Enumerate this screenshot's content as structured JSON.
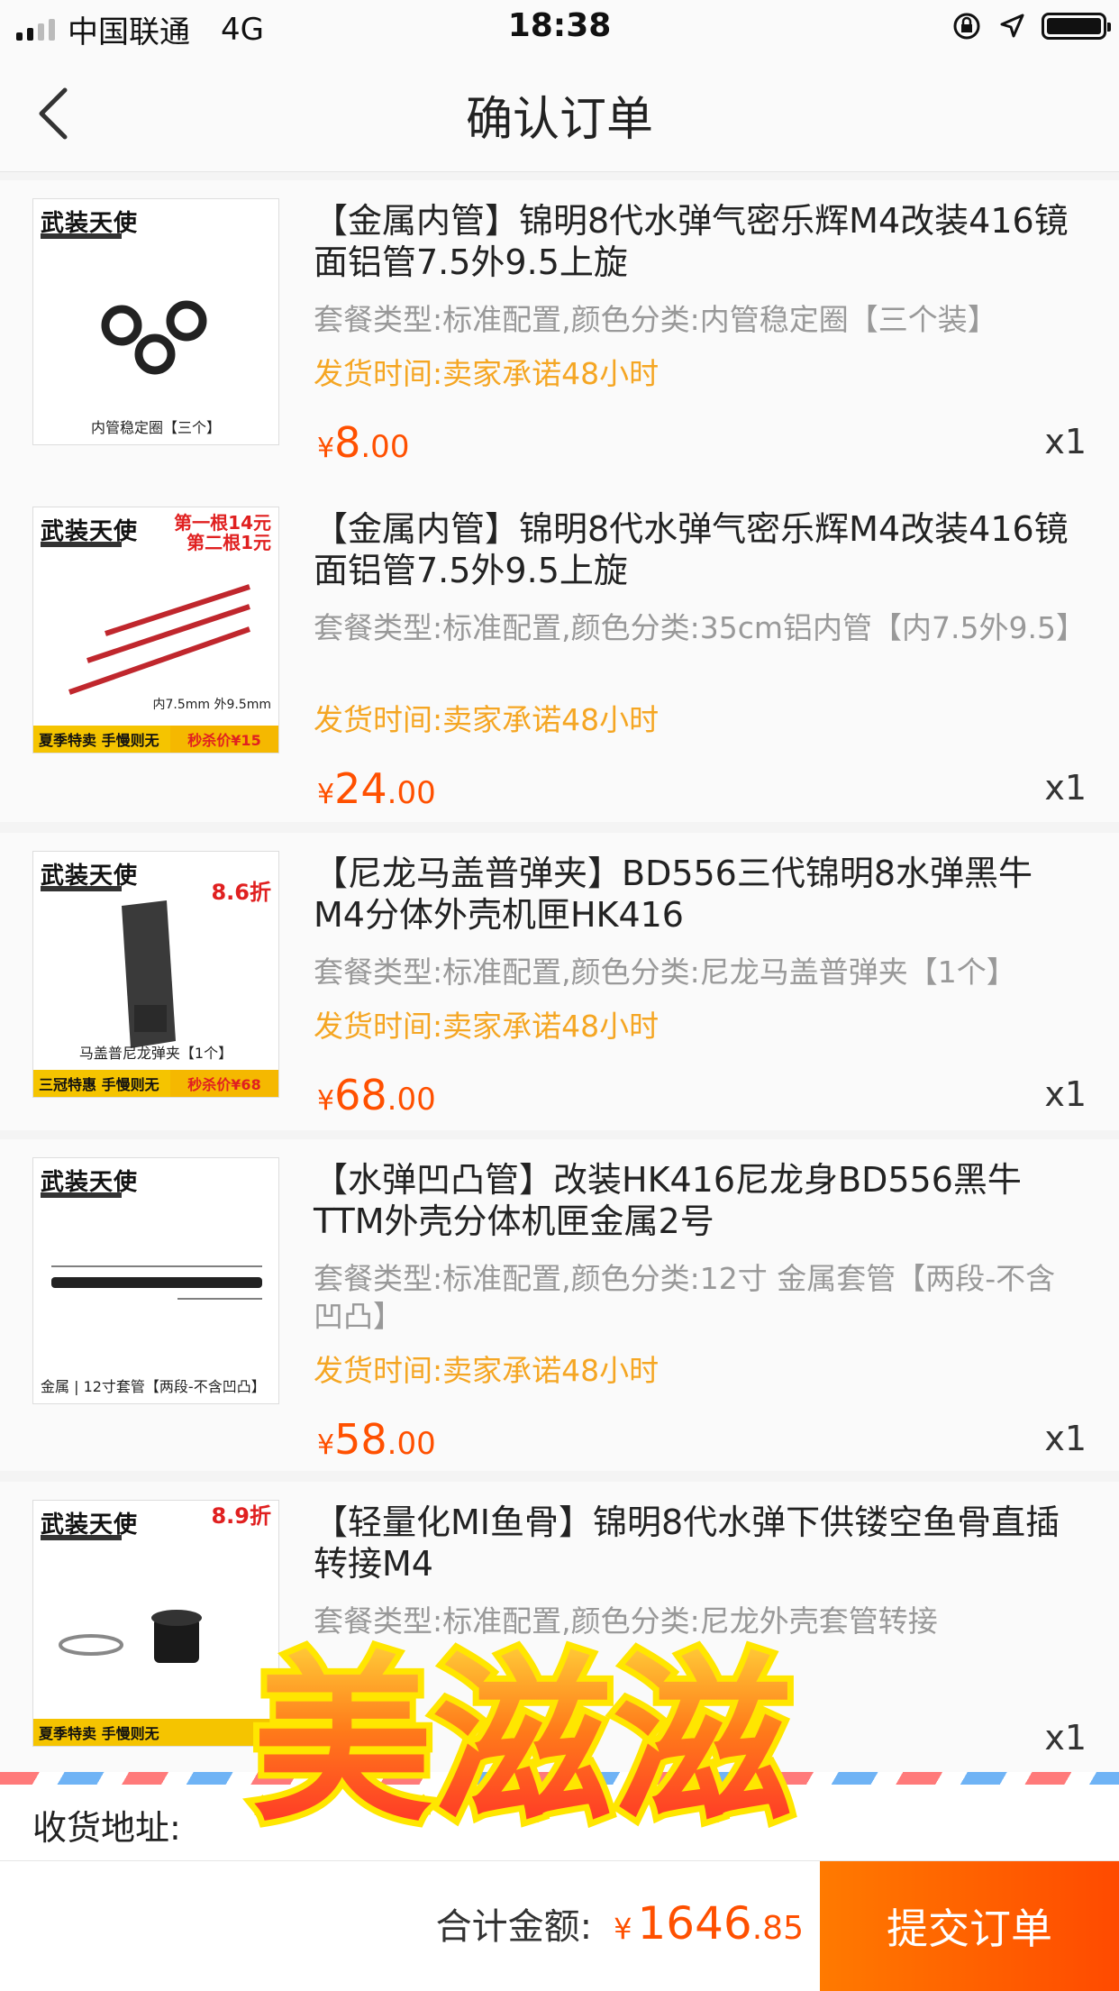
{
  "status_bar": {
    "carrier": "中国联通",
    "network": "4G",
    "time": "18:38"
  },
  "nav": {
    "title": "确认订单",
    "back_icon": "chevron-left-icon"
  },
  "items": [
    {
      "title": "【金属内管】锦明8代水弹气密乐辉M4改装416镜面铝管7.5外9.5上旋",
      "spec": "套餐类型:标准配置,颜色分类:内管稳定圈【三个装】",
      "ship": "发货时间:卖家承诺48小时",
      "price_cur": "¥",
      "price_int": "8",
      "price_dec": ".00",
      "qty": "x1",
      "thumb": {
        "brand": "武装天使",
        "caption": "内管稳定圈【三个】",
        "promo": "",
        "banner_left": "",
        "banner_right": ""
      }
    },
    {
      "title": "【金属内管】锦明8代水弹气密乐辉M4改装416镜面铝管7.5外9.5上旋",
      "spec": "套餐类型:标准配置,颜色分类:35cm铝内管【内7.5外9.5】",
      "ship": "发货时间:卖家承诺48小时",
      "price_cur": "¥",
      "price_int": "24",
      "price_dec": ".00",
      "qty": "x1",
      "thumb": {
        "brand": "武装天使",
        "caption": "内7.5mm 外9.5mm",
        "promo": "第一根14元\n第二根1元",
        "banner_left": "夏季特卖 手慢则无",
        "banner_right": "秒杀价¥15"
      }
    },
    {
      "title": "【尼龙马盖普弹夹】BD556三代锦明8水弹黑牛M4分体外壳机匣HK416",
      "spec": "套餐类型:标准配置,颜色分类:尼龙马盖普弹夹【1个】",
      "ship": "发货时间:卖家承诺48小时",
      "price_cur": "¥",
      "price_int": "68",
      "price_dec": ".00",
      "qty": "x1",
      "thumb": {
        "brand": "武装天使",
        "caption": "马盖普尼龙弹夹【1个】",
        "promo": "8.6折",
        "banner_left": "三冠特惠 手慢则无",
        "banner_right": "秒杀价¥68"
      }
    },
    {
      "title": "【水弹凹凸管】改装HK416尼龙身BD556黑牛TTM外壳分体机匣金属2号",
      "spec": "套餐类型:标准配置,颜色分类:12寸 金属套管【两段-不含凹凸】",
      "ship": "发货时间:卖家承诺48小时",
      "price_cur": "¥",
      "price_int": "58",
      "price_dec": ".00",
      "qty": "x1",
      "thumb": {
        "brand": "武装天使",
        "caption": "金属 | 12寸套管【两段-不含凹凸】",
        "promo": "",
        "banner_left": "",
        "banner_right": ""
      }
    },
    {
      "title": "【轻量化MI鱼骨】锦明8代水弹下供镂空鱼骨直插转接M4",
      "spec": "套餐类型:标准配置,颜色分类:尼龙外壳套管转接",
      "ship": "",
      "price_cur": "",
      "price_int": "",
      "price_dec": "",
      "qty": "x1",
      "thumb": {
        "brand": "武装天使",
        "caption": "",
        "promo": "8.9折",
        "banner_left": "夏季特卖 手慢则无",
        "banner_right": ""
      }
    }
  ],
  "address": {
    "label": "收货地址:"
  },
  "footer": {
    "total_label": "合计金额:",
    "total_cur": "¥",
    "total_int": "1646",
    "total_dec": ".85",
    "submit_label": "提交订单"
  },
  "sticker": {
    "text": "美滋滋"
  },
  "colors": {
    "accent": "#ff5000",
    "ship": "#f5a623",
    "submit_start": "#ff7a00",
    "submit_end": "#ff4a00"
  }
}
